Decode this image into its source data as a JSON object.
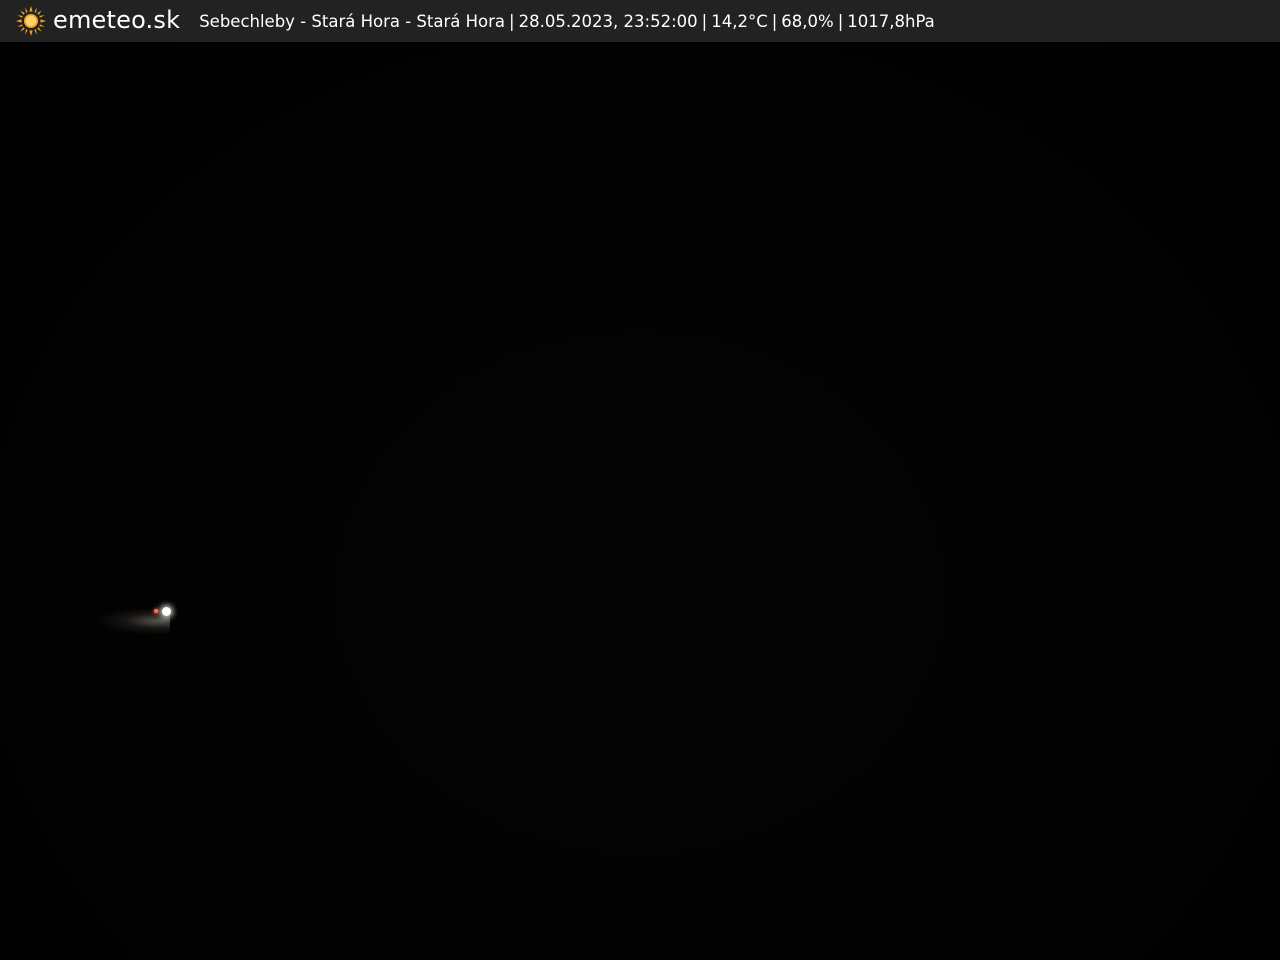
{
  "header": {
    "logo_text": "emeteo.sk",
    "logo_icon": "sun-icon",
    "location": "Sebechleby - Stará Hora - Stará Hora",
    "datetime": "28.05.2023, 23:52:00",
    "temperature": "14,2°C",
    "humidity": "68,0%",
    "pressure": "1017,8hPa",
    "separator": "|"
  },
  "colors": {
    "bar_background": "#222222",
    "text": "#ffffff",
    "sun": "#f5a623",
    "scene": "#000000"
  }
}
